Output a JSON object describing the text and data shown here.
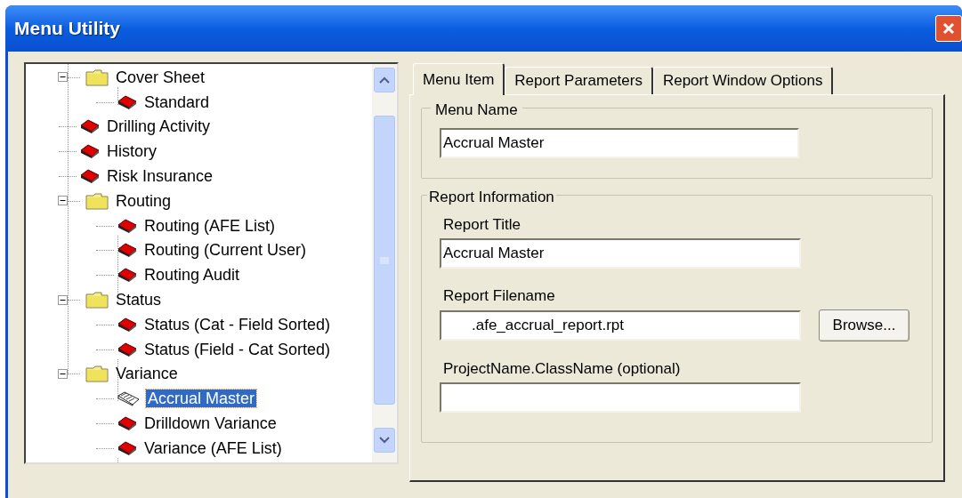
{
  "window": {
    "title": "Menu Utility"
  },
  "tree": [
    {
      "label": "Cover Sheet",
      "kind": "folder",
      "expanded": true,
      "selected": false,
      "children": [
        {
          "label": "Standard",
          "kind": "report",
          "selected": false
        }
      ]
    },
    {
      "label": "Drilling Activity",
      "kind": "report",
      "selected": false
    },
    {
      "label": "History",
      "kind": "report",
      "selected": false
    },
    {
      "label": "Risk Insurance",
      "kind": "report",
      "selected": false
    },
    {
      "label": "Routing",
      "kind": "folder",
      "expanded": true,
      "selected": false,
      "children": [
        {
          "label": "Routing (AFE List)",
          "kind": "report",
          "selected": false
        },
        {
          "label": "Routing (Current User)",
          "kind": "report",
          "selected": false
        },
        {
          "label": "Routing Audit",
          "kind": "report",
          "selected": false
        }
      ]
    },
    {
      "label": "Status",
      "kind": "folder",
      "expanded": true,
      "selected": false,
      "children": [
        {
          "label": "Status (Cat - Field Sorted)",
          "kind": "report",
          "selected": false
        },
        {
          "label": "Status (Field - Cat Sorted)",
          "kind": "report",
          "selected": false
        }
      ]
    },
    {
      "label": "Variance",
      "kind": "folder",
      "expanded": true,
      "selected": false,
      "children": [
        {
          "label": "Accrual Master",
          "kind": "report",
          "selected": true
        },
        {
          "label": "Drilldown Variance",
          "kind": "report",
          "selected": false
        },
        {
          "label": "Variance (AFE List)",
          "kind": "report",
          "selected": false
        }
      ]
    }
  ],
  "tabs": [
    {
      "label": "Menu Item",
      "selected": true
    },
    {
      "label": "Report Parameters",
      "selected": false
    },
    {
      "label": "Report Window Options",
      "selected": false
    }
  ],
  "menu_name": {
    "legend": "Menu Name",
    "value": "Accrual Master"
  },
  "report_information": {
    "legend": "Report Information",
    "report_title": {
      "label": "Report Title",
      "value": "Accrual Master"
    },
    "report_filename": {
      "label": "Report Filename",
      "value": ".afe_accrual_report.rpt"
    },
    "browse_button": "Browse...",
    "class_name": {
      "label": "ProjectName.ClassName (optional)"
    }
  }
}
